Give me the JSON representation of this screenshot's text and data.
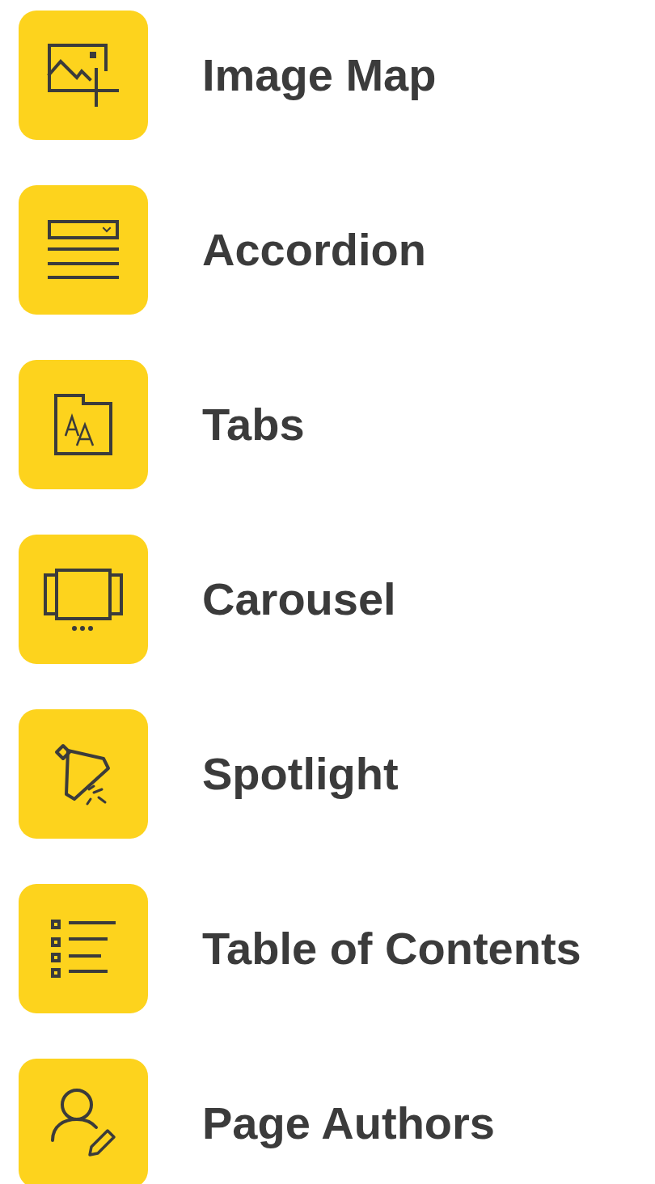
{
  "items": [
    {
      "kind": "imagemap",
      "label": "Image Map"
    },
    {
      "kind": "accordion",
      "label": "Accordion"
    },
    {
      "kind": "tabs",
      "label": "Tabs"
    },
    {
      "kind": "carousel",
      "label": "Carousel"
    },
    {
      "kind": "spotlight",
      "label": "Spotlight"
    },
    {
      "kind": "toc",
      "label": "Table of Contents"
    },
    {
      "kind": "authors",
      "label": "Page Authors"
    }
  ]
}
